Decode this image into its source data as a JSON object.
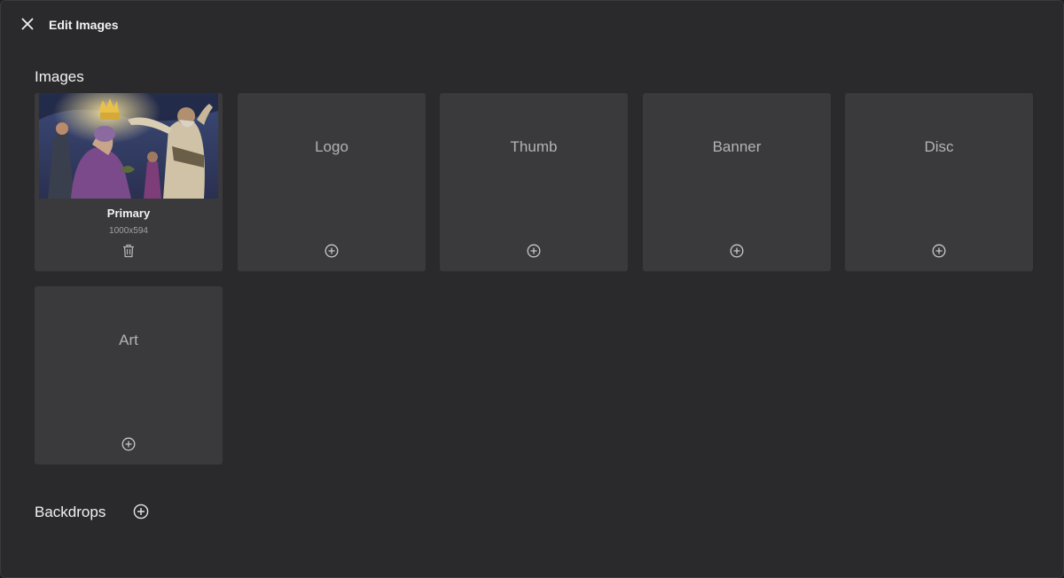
{
  "dialog": {
    "title": "Edit Images"
  },
  "images_section": {
    "title": "Images",
    "primary": {
      "name": "Primary",
      "dimensions": "1000x594"
    },
    "slots": [
      {
        "label": "Logo"
      },
      {
        "label": "Thumb"
      },
      {
        "label": "Banner"
      },
      {
        "label": "Disc"
      },
      {
        "label": "Art"
      }
    ]
  },
  "backdrops_section": {
    "title": "Backdrops"
  },
  "colors": {
    "background": "#2a2a2c",
    "card": "#3a3a3c",
    "text": "#f2f2f2",
    "muted_text": "#b3b3b5"
  }
}
